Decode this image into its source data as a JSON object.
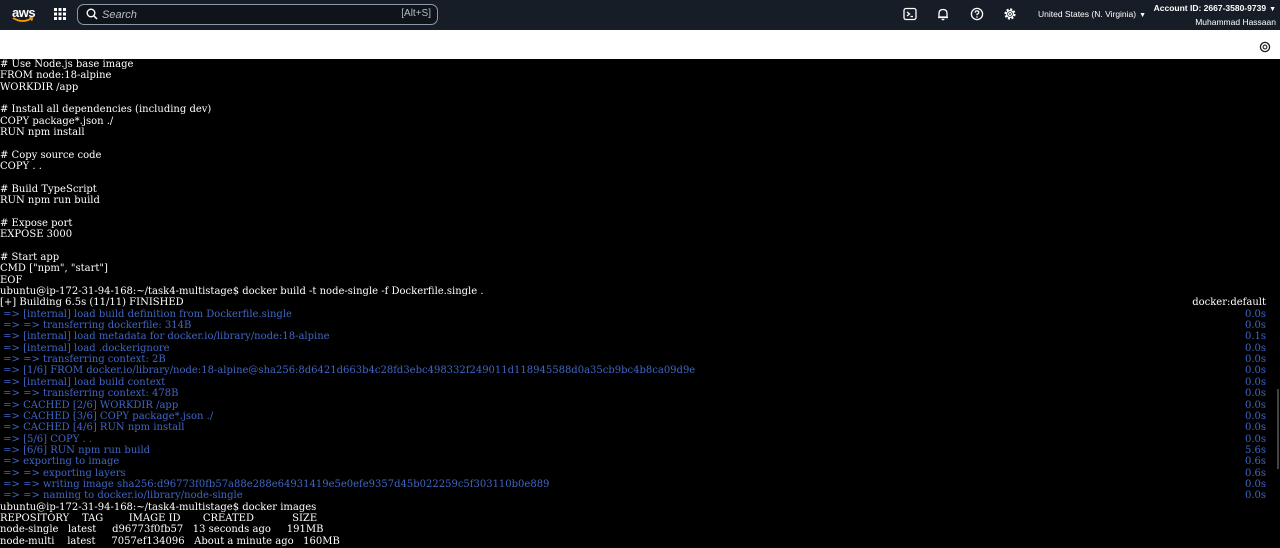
{
  "nav": {
    "logo_text": "aws",
    "search_placeholder": "Search",
    "search_shortcut": "[Alt+S]",
    "region": "United States (N. Virginia)",
    "account_id": "Account ID: 2667-3580-9739",
    "user": "Muhammad Hassaan"
  },
  "terminal": {
    "lines": [
      {
        "text": "# Use Node.js base image",
        "style": "plain"
      },
      {
        "text": "FROM node:18-alpine",
        "style": "plain"
      },
      {
        "text": "WORKDIR /app",
        "style": "plain"
      },
      {
        "text": "",
        "style": "plain"
      },
      {
        "text": "# Install all dependencies (including dev)",
        "style": "plain"
      },
      {
        "text": "COPY package*.json ./",
        "style": "plain"
      },
      {
        "text": "RUN npm install",
        "style": "plain"
      },
      {
        "text": "",
        "style": "plain"
      },
      {
        "text": "# Copy source code",
        "style": "plain"
      },
      {
        "text": "COPY . .",
        "style": "plain"
      },
      {
        "text": "",
        "style": "plain"
      },
      {
        "text": "# Build TypeScript",
        "style": "plain"
      },
      {
        "text": "RUN npm run build",
        "style": "plain"
      },
      {
        "text": "",
        "style": "plain"
      },
      {
        "text": "# Expose port",
        "style": "plain"
      },
      {
        "text": "EXPOSE 3000",
        "style": "plain"
      },
      {
        "text": "",
        "style": "plain"
      },
      {
        "text": "# Start app",
        "style": "plain"
      },
      {
        "text": "CMD [\"npm\", \"start\"]",
        "style": "plain"
      },
      {
        "text": "EOF",
        "style": "plain"
      },
      {
        "text": "ubuntu@ip-172-31-94-168:~/task4-multistage$ docker build -t node-single -f Dockerfile.single .",
        "style": "plain"
      },
      {
        "text": "[+] Building 6.5s (11/11) FINISHED",
        "style": "plain",
        "right": "docker:default",
        "right_style": "plain"
      },
      {
        "text": " => [internal] load build definition from Dockerfile.single",
        "style": "blue",
        "right": "0.0s",
        "right_style": "blue"
      },
      {
        "text": " => => transferring dockerfile: 314B",
        "style": "blue",
        "right": "0.0s",
        "right_style": "blue"
      },
      {
        "text": " => [internal] load metadata for docker.io/library/node:18-alpine",
        "style": "blue",
        "right": "0.1s",
        "right_style": "blue"
      },
      {
        "text": " => [internal] load .dockerignore",
        "style": "blue",
        "right": "0.0s",
        "right_style": "blue"
      },
      {
        "text": " => => transferring context: 2B",
        "style": "blue",
        "right": "0.0s",
        "right_style": "blue"
      },
      {
        "text": " => [1/6] FROM docker.io/library/node:18-alpine@sha256:8d6421d663b4c28fd3ebc498332f249011d118945588d0a35cb9bc4b8ca09d9e",
        "style": "blue",
        "right": "0.0s",
        "right_style": "blue"
      },
      {
        "text": " => [internal] load build context",
        "style": "blue",
        "right": "0.0s",
        "right_style": "blue"
      },
      {
        "text": " => => transferring context: 478B",
        "style": "blue",
        "right": "0.0s",
        "right_style": "blue"
      },
      {
        "text": " => CACHED [2/6] WORKDIR /app",
        "style": "blue",
        "right": "0.0s",
        "right_style": "blue"
      },
      {
        "text": " => CACHED [3/6] COPY package*.json ./",
        "style": "blue",
        "right": "0.0s",
        "right_style": "blue"
      },
      {
        "text": " => CACHED [4/6] RUN npm install",
        "style": "blue",
        "right": "0.0s",
        "right_style": "blue"
      },
      {
        "text": " => [5/6] COPY . .",
        "style": "blue",
        "right": "0.0s",
        "right_style": "blue"
      },
      {
        "text": " => [6/6] RUN npm run build",
        "style": "blue",
        "right": "5.6s",
        "right_style": "blue"
      },
      {
        "text": " => exporting to image",
        "style": "blue",
        "right": "0.6s",
        "right_style": "blue"
      },
      {
        "text": " => => exporting layers",
        "style": "blue",
        "right": "0.6s",
        "right_style": "blue"
      },
      {
        "text": " => => writing image sha256:d96773f0fb57a88e288e64931419e5e0efe9357d45b022259c5f303110b0e889",
        "style": "blue",
        "right": "0.0s",
        "right_style": "blue"
      },
      {
        "text": " => => naming to docker.io/library/node-single",
        "style": "blue",
        "right": "0.0s",
        "right_style": "blue"
      },
      {
        "text": "ubuntu@ip-172-31-94-168:~/task4-multistage$ docker images",
        "style": "plain"
      },
      {
        "text": "REPOSITORY    TAG        IMAGE ID       CREATED            SIZE",
        "style": "plain"
      },
      {
        "text": "node-single   latest     d96773f0fb57   13 seconds ago     191MB",
        "style": "plain"
      },
      {
        "text": "node-multi    latest     7057ef134096   About a minute ago   160MB",
        "style": "plain"
      }
    ]
  },
  "icons": {
    "grid": "grid-icon",
    "cloudshell": "cloudshell-icon",
    "bell": "bell-icon",
    "help": "help-icon",
    "gear": "gear-icon",
    "settings_circle": "settings-circle-icon"
  }
}
